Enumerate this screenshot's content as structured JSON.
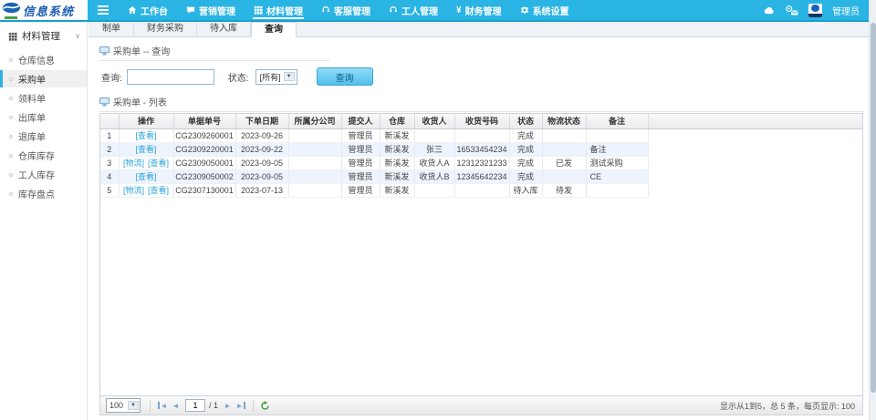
{
  "topbar": {
    "brand": "信息系统",
    "menu": [
      {
        "label": "工作台",
        "icon": "home",
        "active": false
      },
      {
        "label": "营销管理",
        "icon": "chat",
        "active": false
      },
      {
        "label": "材料管理",
        "icon": "grid",
        "active": true
      },
      {
        "label": "客服管理",
        "icon": "headset",
        "active": false
      },
      {
        "label": "工人管理",
        "icon": "headset",
        "active": false
      },
      {
        "label": "财务管理",
        "icon": "yen",
        "active": false
      },
      {
        "label": "系统设置",
        "icon": "gear",
        "active": false
      }
    ],
    "user_name": "管理员"
  },
  "sidebar": {
    "title": "材料管理",
    "active_index": 1,
    "items": [
      "仓库信息",
      "采购单",
      "领料单",
      "出库单",
      "退库单",
      "仓库库存",
      "工人库存",
      "库存盘点"
    ]
  },
  "tabs": {
    "active_index": 3,
    "items": [
      "制单",
      "财务采购",
      "待入库",
      "查询"
    ]
  },
  "sections": {
    "query_title": "采购单 -- 查询",
    "list_title": "采购单 - 列表"
  },
  "query_form": {
    "query_label": "查询:",
    "query_value": "",
    "status_label": "状态:",
    "status_value": "[所有]",
    "search_button": "查询"
  },
  "table": {
    "headers": [
      "",
      "操作",
      "单据单号",
      "下单日期",
      "所属分公司",
      "提交人",
      "仓库",
      "收货人",
      "收货号码",
      "状态",
      "物流状态",
      "备注"
    ],
    "rows": [
      {
        "num": "1",
        "ops": [
          "[查看]"
        ],
        "order_no": "CG2309260001",
        "date": "2023-09-26",
        "branch": "",
        "submitter": "管理员",
        "warehouse": "新溪发",
        "receiver": "",
        "phone": "",
        "status": "完成",
        "logistics": "",
        "remark": ""
      },
      {
        "num": "2",
        "ops": [
          "[查看]"
        ],
        "order_no": "CG2309220001",
        "date": "2023-09-22",
        "branch": "",
        "submitter": "管理员",
        "warehouse": "新溪发",
        "receiver": "张三",
        "phone": "16533454234",
        "status": "完成",
        "logistics": "",
        "remark": "备注"
      },
      {
        "num": "3",
        "ops": [
          "[物流]",
          "[查看]"
        ],
        "order_no": "CG2309050001",
        "date": "2023-09-05",
        "branch": "",
        "submitter": "管理员",
        "warehouse": "新溪发",
        "receiver": "收货人A",
        "phone": "12312321233",
        "status": "完成",
        "logistics": "已发",
        "remark": "测试采购"
      },
      {
        "num": "4",
        "ops": [
          "[查看]"
        ],
        "order_no": "CG2309050002",
        "date": "2023-09-05",
        "branch": "",
        "submitter": "管理员",
        "warehouse": "新溪发",
        "receiver": "收货人B",
        "phone": "12345642234",
        "status": "完成",
        "logistics": "",
        "remark": "CE"
      },
      {
        "num": "5",
        "ops": [
          "[物流]",
          "[查看]"
        ],
        "order_no": "CG2307130001",
        "date": "2023-07-13",
        "branch": "",
        "submitter": "管理员",
        "warehouse": "新溪发",
        "receiver": "",
        "phone": "",
        "status": "待入库",
        "logistics": "待发",
        "remark": ""
      }
    ]
  },
  "pagination": {
    "page_size": "100",
    "page_value": "1",
    "page_total": "/ 1",
    "summary": "显示从1到5，总 5 条，每页显示: 100"
  },
  "colors": {
    "topbar": "#2ab4e4",
    "accent_link": "#2aa3dc",
    "stripe_row": "#edf4fd",
    "brand_text": "#1e5fb0"
  }
}
